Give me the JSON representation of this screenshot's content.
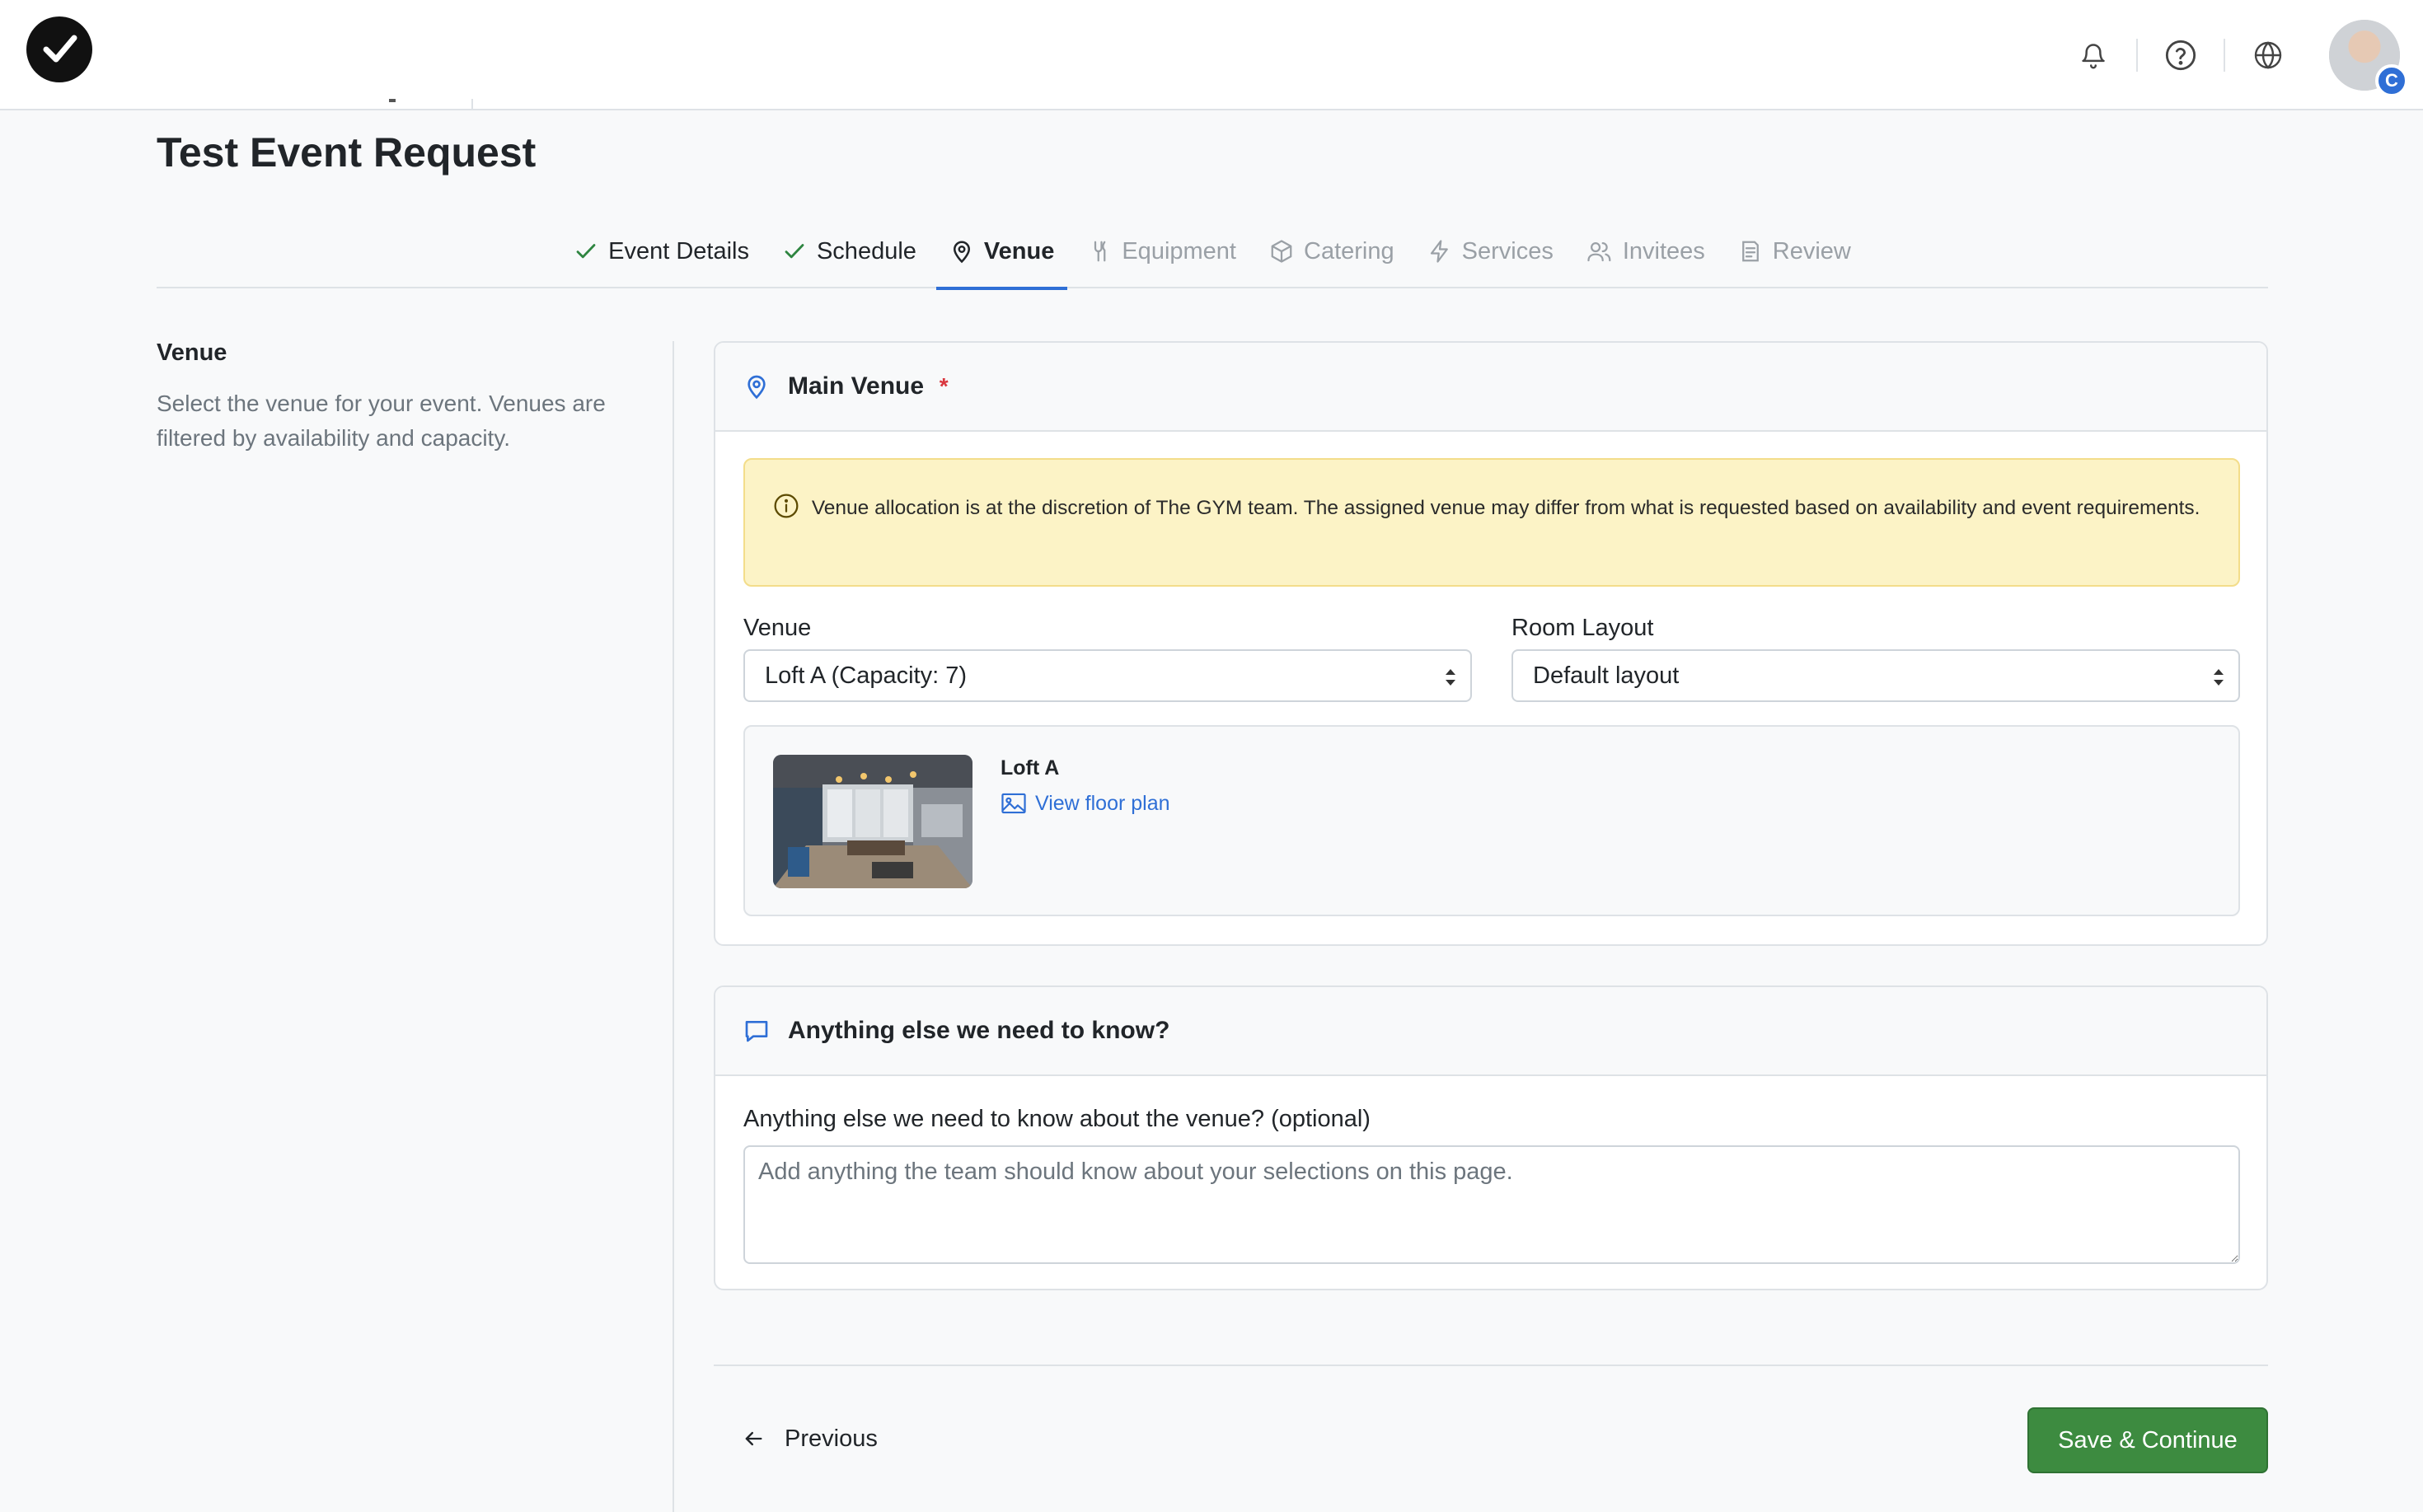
{
  "page": {
    "title": "Test Event Request"
  },
  "tabs": [
    {
      "label": "Event Details",
      "state": "done",
      "icon": "check-icon"
    },
    {
      "label": "Schedule",
      "state": "done",
      "icon": "check-icon"
    },
    {
      "label": "Venue",
      "state": "active",
      "icon": "map-pin-icon"
    },
    {
      "label": "Equipment",
      "state": "pending",
      "icon": "tool-icon"
    },
    {
      "label": "Catering",
      "state": "pending",
      "icon": "box-icon"
    },
    {
      "label": "Services",
      "state": "pending",
      "icon": "bolt-icon"
    },
    {
      "label": "Invitees",
      "state": "pending",
      "icon": "users-icon"
    },
    {
      "label": "Review",
      "state": "pending",
      "icon": "clipboard-icon"
    }
  ],
  "sidebar": {
    "heading": "Venue",
    "description": "Select the venue for your event. Venues are filtered by availability and capacity."
  },
  "main_venue": {
    "title": "Main Venue",
    "required_marker": "*",
    "notice": "Venue allocation is at the discretion of The GYM team. The assigned venue may differ from what is requested based on availability and event requirements.",
    "venue_label": "Venue",
    "venue_value": "Loft A (Capacity: 7)",
    "layout_label": "Room Layout",
    "layout_value": "Default layout",
    "selected_venue_name": "Loft A",
    "floor_plan_link": "View floor plan"
  },
  "notes": {
    "title": "Anything else we need to know?",
    "label": "Anything else we need to know about the venue? (optional)",
    "placeholder": "Add anything the team should know about your selections on this page."
  },
  "footer": {
    "previous_label": "Previous",
    "save_label": "Save & Continue"
  },
  "colors": {
    "accent": "#2f6fd6",
    "success": "#3d8b40",
    "alert_bg": "#fcf3c6",
    "required": "#d9363e"
  }
}
